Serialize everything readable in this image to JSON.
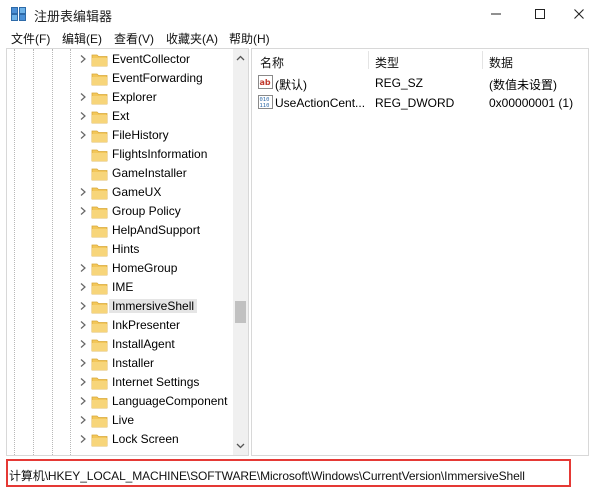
{
  "window": {
    "title": "注册表编辑器",
    "buttons": {
      "minimize": "minimize",
      "maximize": "maximize",
      "close": "close"
    }
  },
  "menu": [
    {
      "label": "文件(F)"
    },
    {
      "label": "编辑(E)"
    },
    {
      "label": "查看(V)"
    },
    {
      "label": "收藏夹(A)"
    },
    {
      "label": "帮助(H)"
    }
  ],
  "tree": {
    "selected": "ImmersiveShell",
    "items": [
      {
        "label": "EventCollector",
        "expandable": true
      },
      {
        "label": "EventForwarding",
        "expandable": false
      },
      {
        "label": "Explorer",
        "expandable": true
      },
      {
        "label": "Ext",
        "expandable": true
      },
      {
        "label": "FileHistory",
        "expandable": true
      },
      {
        "label": "FlightsInformation",
        "expandable": false
      },
      {
        "label": "GameInstaller",
        "expandable": false
      },
      {
        "label": "GameUX",
        "expandable": true
      },
      {
        "label": "Group Policy",
        "expandable": true
      },
      {
        "label": "HelpAndSupport",
        "expandable": false
      },
      {
        "label": "Hints",
        "expandable": false
      },
      {
        "label": "HomeGroup",
        "expandable": true
      },
      {
        "label": "IME",
        "expandable": true
      },
      {
        "label": "ImmersiveShell",
        "expandable": true
      },
      {
        "label": "InkPresenter",
        "expandable": true
      },
      {
        "label": "InstallAgent",
        "expandable": true
      },
      {
        "label": "Installer",
        "expandable": true
      },
      {
        "label": "Internet Settings",
        "expandable": true
      },
      {
        "label": "LanguageComponent",
        "expandable": true
      },
      {
        "label": "Live",
        "expandable": true
      },
      {
        "label": "Lock Screen",
        "expandable": true
      }
    ]
  },
  "list": {
    "columns": {
      "name": "名称",
      "type": "类型",
      "data": "数据"
    },
    "rows": [
      {
        "name": "(默认)",
        "type": "REG_SZ",
        "data": "(数值未设置)",
        "icon": "string-value-icon"
      },
      {
        "name": "UseActionCent...",
        "type": "REG_DWORD",
        "data": "0x00000001 (1)",
        "icon": "binary-value-icon"
      }
    ]
  },
  "status": {
    "path": "计算机\\HKEY_LOCAL_MACHINE\\SOFTWARE\\Microsoft\\Windows\\CurrentVersion\\ImmersiveShell",
    "highlight_color": "#e53935"
  },
  "colors": {
    "folder": "#f3c75a",
    "selection": "#e5e5e5",
    "scrollbar_thumb": "#c1c1c1"
  }
}
